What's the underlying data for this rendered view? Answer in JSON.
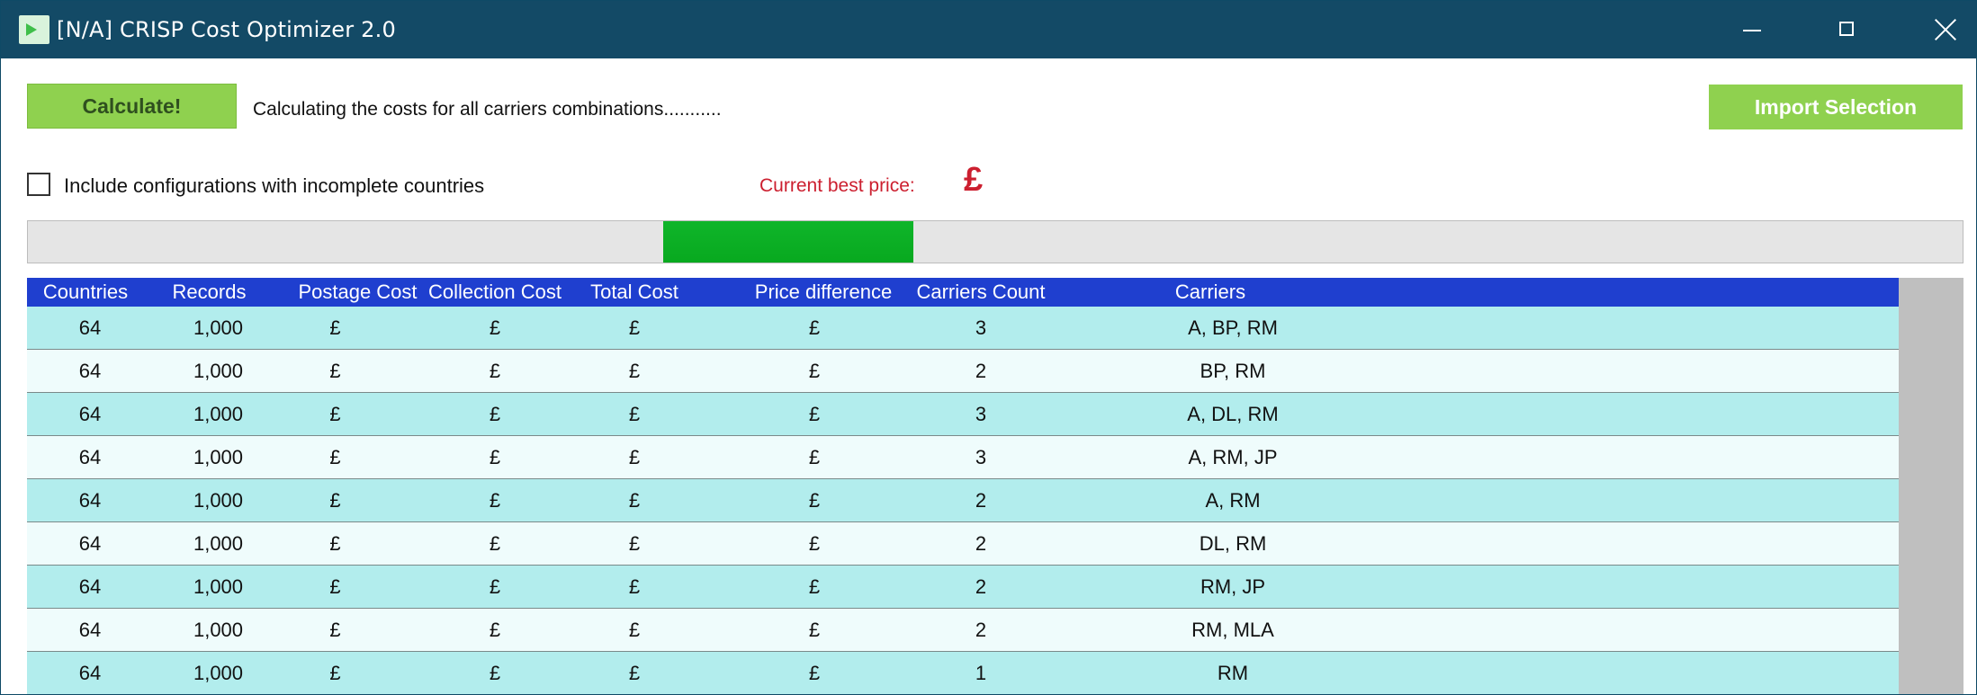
{
  "window": {
    "title": "[N/A] CRISP Cost Optimizer 2.0",
    "controls": {
      "minimize": "minimize",
      "maximize": "maximize",
      "close": "close"
    }
  },
  "toolbar": {
    "calculate_label": "Calculate!",
    "status_text": "Calculating the costs for all carriers combinations...........",
    "import_label": "Import Selection"
  },
  "options": {
    "incomplete_label": "Include configurations with incomplete countries",
    "incomplete_checked": false
  },
  "best_price": {
    "label": "Current best price:",
    "value": "£"
  },
  "progress": {
    "fraction": 0.09
  },
  "colors": {
    "titlebar": "#134a66",
    "button_green": "#8fd14f",
    "accent_red": "#cc1f2f",
    "header_blue": "#1f3fcf",
    "row_odd": "#b2eded",
    "row_even": "#effcfc",
    "progress_fill": "#0fb52a"
  },
  "table": {
    "columns": [
      "Countries",
      "Records",
      "Postage Cost",
      "Collection Cost",
      "Total Cost",
      "Price difference",
      "Carriers Count",
      "Carriers"
    ],
    "rows": [
      [
        "64",
        "1,000",
        "£",
        "£",
        "£",
        "£",
        "3",
        "A, BP, RM"
      ],
      [
        "64",
        "1,000",
        "£",
        "£",
        "£",
        "£",
        "2",
        "BP, RM"
      ],
      [
        "64",
        "1,000",
        "£",
        "£",
        "£",
        "£",
        "3",
        "A, DL, RM"
      ],
      [
        "64",
        "1,000",
        "£",
        "£",
        "£",
        "£",
        "3",
        "A, RM, JP"
      ],
      [
        "64",
        "1,000",
        "£",
        "£",
        "£",
        "£",
        "2",
        "A, RM"
      ],
      [
        "64",
        "1,000",
        "£",
        "£",
        "£",
        "£",
        "2",
        "DL, RM"
      ],
      [
        "64",
        "1,000",
        "£",
        "£",
        "£",
        "£",
        "2",
        "RM, JP"
      ],
      [
        "64",
        "1,000",
        "£",
        "£",
        "£",
        "£",
        "2",
        "RM, MLA"
      ],
      [
        "64",
        "1,000",
        "£",
        "£",
        "£",
        "£",
        "1",
        "RM"
      ]
    ]
  }
}
